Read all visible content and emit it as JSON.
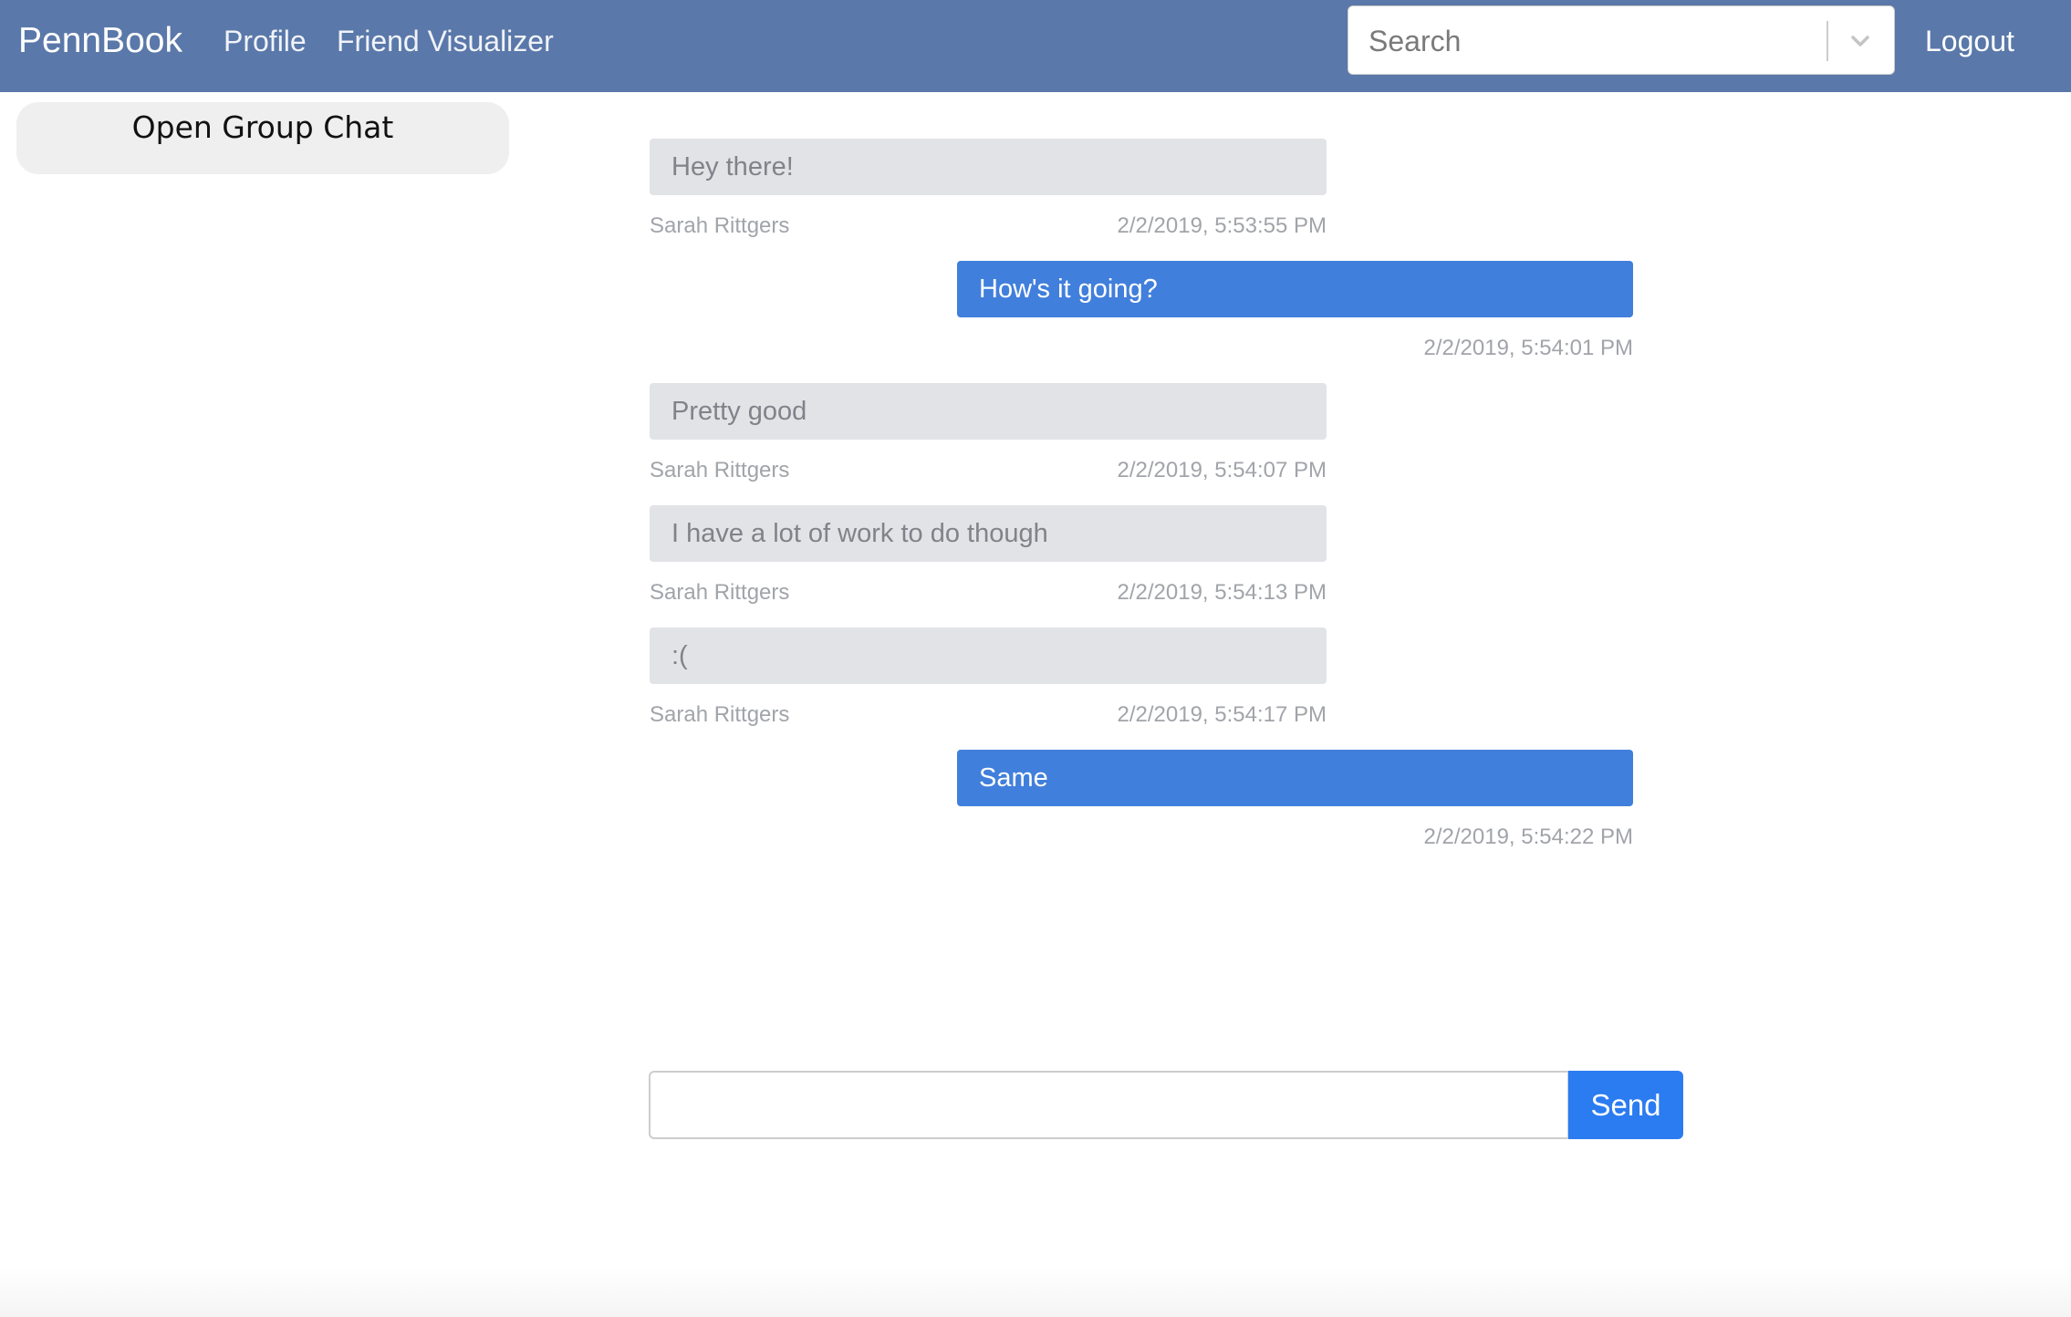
{
  "navbar": {
    "brand": "PennBook",
    "links": [
      {
        "label": "Profile"
      },
      {
        "label": "Friend Visualizer"
      }
    ],
    "search": {
      "placeholder": "Search"
    },
    "logout_label": "Logout",
    "background_color": "#5a78a9"
  },
  "sidebar": {
    "group_chat_label": "Open Group Chat"
  },
  "messages": [
    {
      "text": "Hey there!",
      "sender": "Sarah Rittgers",
      "time": "2/2/2019, 5:53:55 PM",
      "direction": "incoming"
    },
    {
      "text": "How's it going?",
      "sender": "",
      "time": "2/2/2019, 5:54:01 PM",
      "direction": "outgoing"
    },
    {
      "text": "Pretty good",
      "sender": "Sarah Rittgers",
      "time": "2/2/2019, 5:54:07 PM",
      "direction": "incoming"
    },
    {
      "text": "I have a lot of work to do though",
      "sender": "Sarah Rittgers",
      "time": "2/2/2019, 5:54:13 PM",
      "direction": "incoming"
    },
    {
      "text": ":(",
      "sender": "Sarah Rittgers",
      "time": "2/2/2019, 5:54:17 PM",
      "direction": "incoming"
    },
    {
      "text": "Same",
      "sender": "",
      "time": "2/2/2019, 5:54:22 PM",
      "direction": "outgoing"
    }
  ],
  "composer": {
    "value": "",
    "send_label": "Send"
  },
  "colors": {
    "incoming_bubble": "#e2e3e6",
    "outgoing_bubble": "#417fdc",
    "send_button": "#2b7bf1"
  }
}
